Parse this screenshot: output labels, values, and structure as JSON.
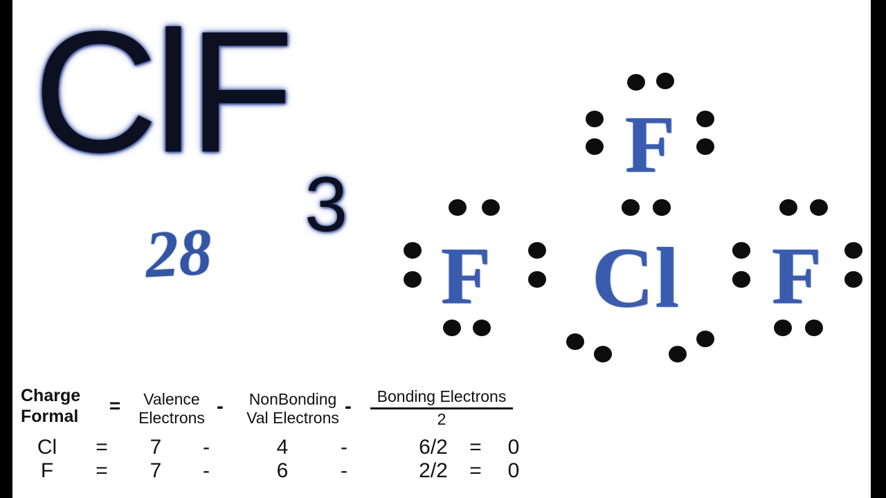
{
  "colors": {
    "ink_blue": "#3a5cae",
    "dot_black": "#0d0d0d",
    "title_dark": "#0c1020",
    "letterbox": "#000000",
    "canvas": "#ffffff"
  },
  "title": {
    "formula_main": "ClF",
    "formula_subscript": "3",
    "electron_count": "28"
  },
  "lewis_structure": {
    "molecule": "ClF3",
    "central_atom": "Cl",
    "atoms": [
      {
        "symbol": "F",
        "position": "top"
      },
      {
        "symbol": "F",
        "position": "left"
      },
      {
        "symbol": "Cl",
        "position": "center"
      },
      {
        "symbol": "F",
        "position": "right"
      }
    ]
  },
  "formula": {
    "label_line1": "Charge",
    "label_line2": "Formal",
    "equals": "=",
    "term1_line1": "Valence",
    "term1_line2": "Electrons",
    "minus1": "-",
    "term2_line1": "NonBonding",
    "term2_line2": "Val Electrons",
    "minus2": "-",
    "fraction_numerator": "Bonding Electrons",
    "fraction_denominator": "2"
  },
  "table": {
    "rows": [
      {
        "symbol": "Cl",
        "equals": "=",
        "valence": "7",
        "minus1": "-",
        "nonbonding": "4",
        "minus2": "-",
        "bonding_over_two": "6/2",
        "equals2": "=",
        "result": "0"
      },
      {
        "symbol": "F",
        "equals": "=",
        "valence": "7",
        "minus1": "-",
        "nonbonding": "6",
        "minus2": "-",
        "bonding_over_two": "2/2",
        "equals2": "=",
        "result": "0"
      }
    ]
  }
}
